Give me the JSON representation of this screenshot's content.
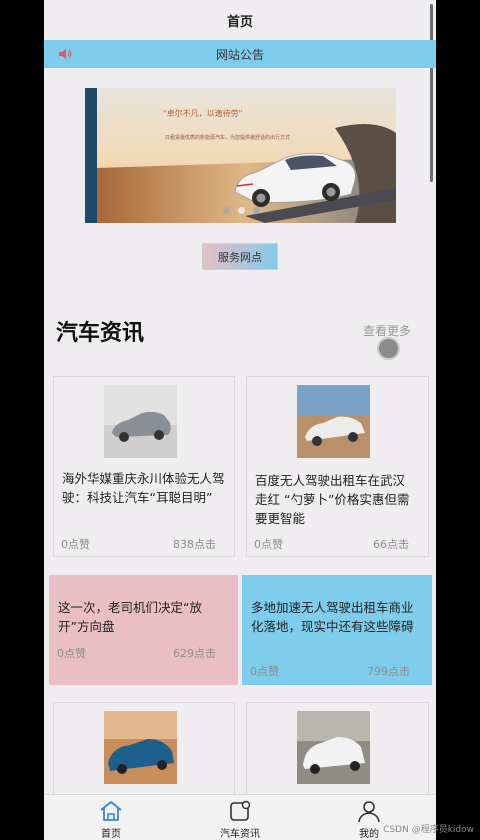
{
  "nav": {
    "title": "首页"
  },
  "notice": {
    "label": "网站公告",
    "icon": "speaker-icon"
  },
  "banner": {
    "slogan": "\"卓尔不凡，以逸待劳\"",
    "subtitle": "只租赁最优质的新能源汽车，为您提供最舒适的出行方式",
    "slides_total": 3,
    "slide_active": 2
  },
  "service": {
    "label": "服务网点"
  },
  "news": {
    "title": "汽车资讯",
    "more_label": "查看更多",
    "cards": [
      {
        "title": "海外华媒重庆永川体验无人驾驶：科技让汽车“耳聪目明”",
        "likes": "0点赞",
        "clicks": "838点击"
      },
      {
        "title": "百度无人驾驶出租车在武汉走红 “勺萝卜”价格实惠但需要更智能",
        "likes": "0点赞",
        "clicks": "66点击"
      },
      {
        "title": "这一次，老司机们决定“放开”方向盘",
        "likes": "0点赞",
        "clicks": "629点击"
      },
      {
        "title": "多地加速无人驾驶出租车商业化落地，现实中还有这些障碍",
        "likes": "0点赞",
        "clicks": "799点击"
      }
    ]
  },
  "tabbar": {
    "items": [
      {
        "label": "首页",
        "icon": "home-icon",
        "active": true
      },
      {
        "label": "汽车资讯",
        "icon": "news-icon",
        "active": false
      },
      {
        "label": "我的",
        "icon": "user-icon",
        "active": false
      }
    ]
  },
  "watermark": "CSDN @程序员kidow",
  "colors": {
    "accent_blue": "#7ecdec",
    "accent_pink": "#e9bfc3",
    "tab_active": "#3b84d8"
  }
}
